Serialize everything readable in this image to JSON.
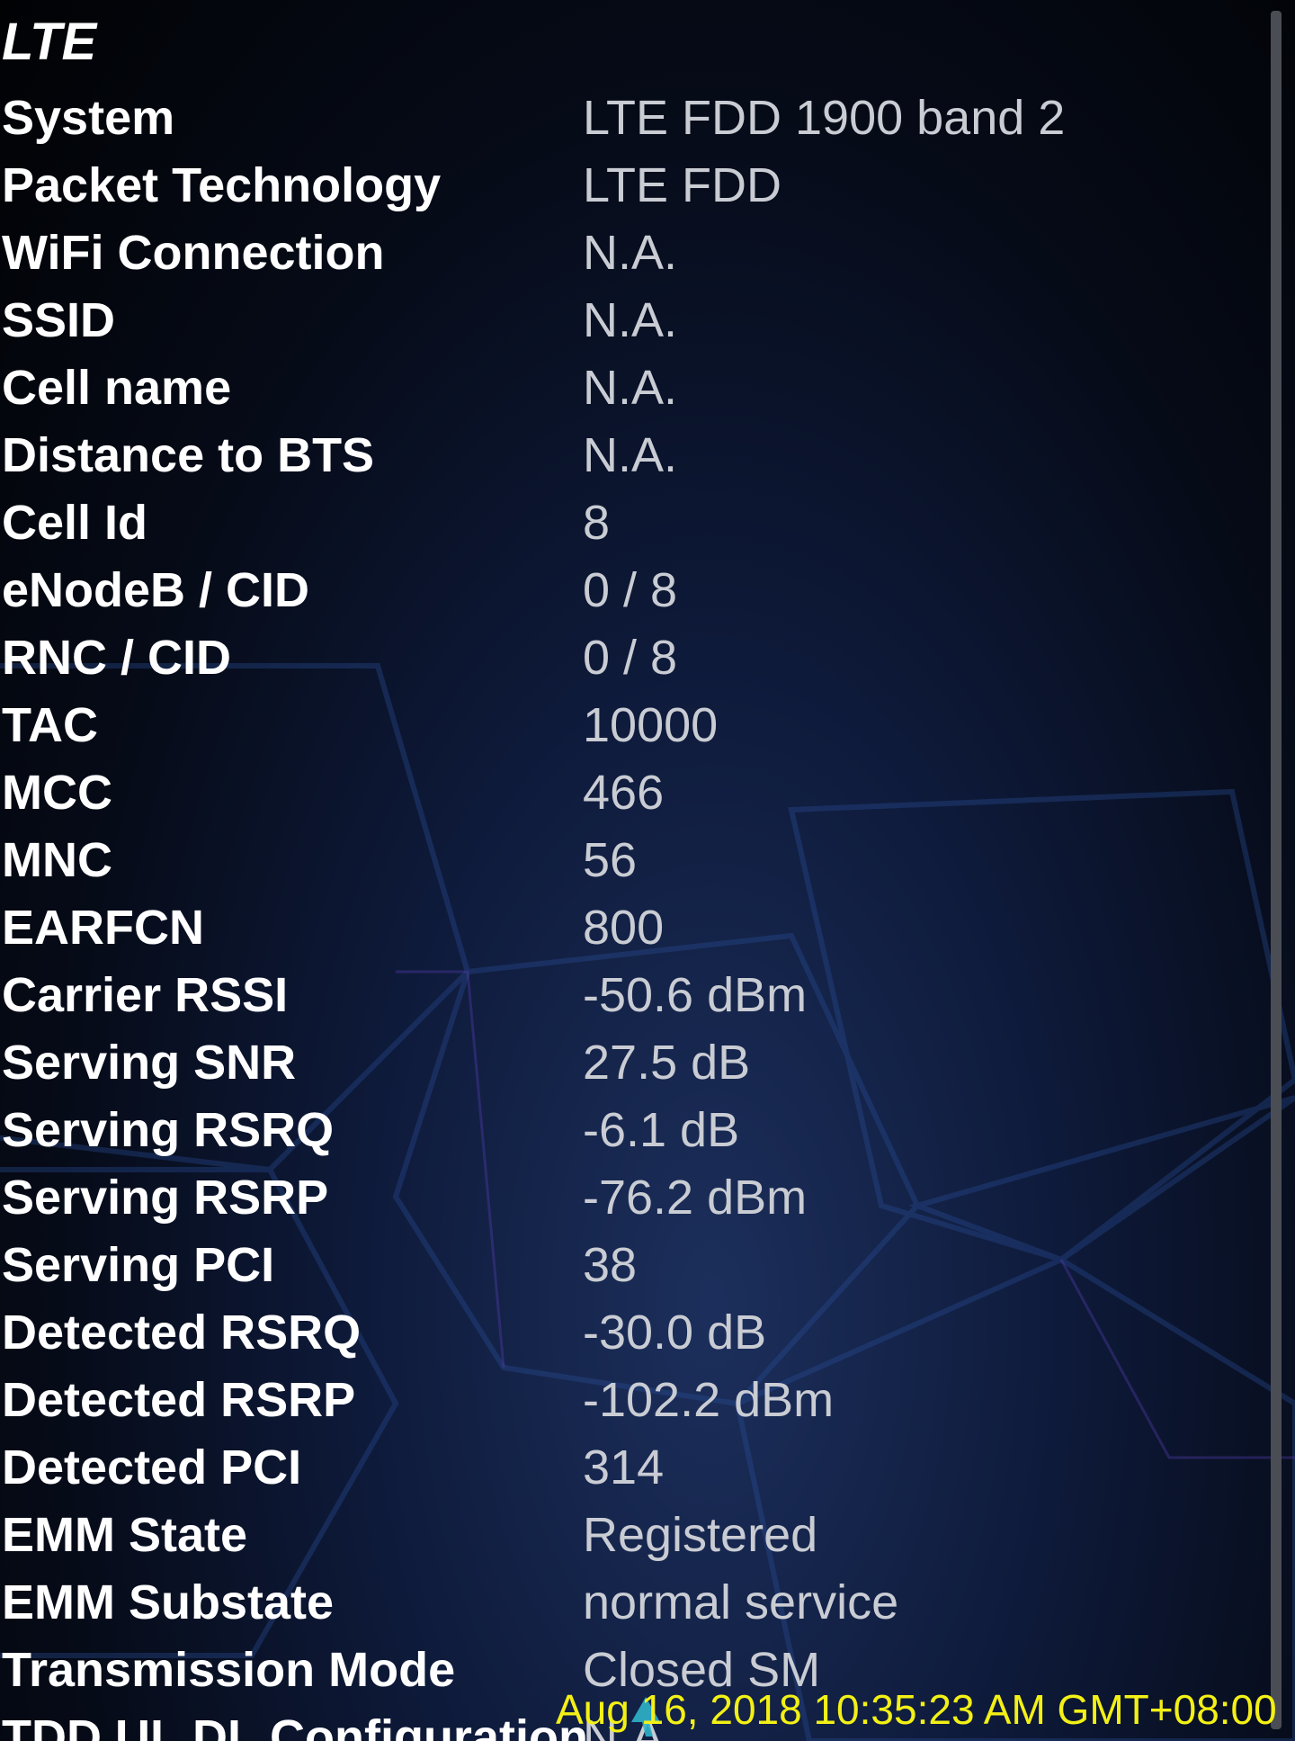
{
  "section": {
    "title": "LTE"
  },
  "rows": [
    {
      "label": "System",
      "value": "LTE FDD 1900 band 2"
    },
    {
      "label": "Packet Technology",
      "value": "LTE FDD"
    },
    {
      "label": "WiFi Connection",
      "value": "N.A."
    },
    {
      "label": "SSID",
      "value": "N.A."
    },
    {
      "label": "Cell name",
      "value": "N.A."
    },
    {
      "label": "Distance to BTS",
      "value": "N.A."
    },
    {
      "label": "Cell Id",
      "value": "8"
    },
    {
      "label": "eNodeB / CID",
      "value": "0 / 8"
    },
    {
      "label": "RNC / CID",
      "value": "0 / 8"
    },
    {
      "label": "TAC",
      "value": "10000"
    },
    {
      "label": "MCC",
      "value": "466"
    },
    {
      "label": "MNC",
      "value": "56"
    },
    {
      "label": "EARFCN",
      "value": "800"
    },
    {
      "label": "Carrier RSSI",
      "value": "-50.6 dBm"
    },
    {
      "label": "Serving SNR",
      "value": "27.5 dB"
    },
    {
      "label": "Serving RSRQ",
      "value": "-6.1 dB"
    },
    {
      "label": "Serving RSRP",
      "value": "-76.2 dBm"
    },
    {
      "label": "Serving PCI",
      "value": "38"
    },
    {
      "label": "Detected RSRQ",
      "value": "-30.0 dB"
    },
    {
      "label": "Detected RSRP",
      "value": "-102.2 dBm"
    },
    {
      "label": "Detected PCI",
      "value": "314"
    },
    {
      "label": "EMM State",
      "value": "Registered"
    },
    {
      "label": "EMM Substate",
      "value": "normal service"
    },
    {
      "label": "Transmission Mode",
      "value": "Closed SM"
    },
    {
      "label": "TDD UL DL Configuration",
      "value": "N.A."
    }
  ],
  "overlay": {
    "timestamp": "Aug 16, 2018 10:35:23 AM GMT+08:00"
  },
  "colors": {
    "label": "#ffffff",
    "value": "#c9ccd3",
    "timestamp": "#f3f016",
    "background": "#0a1430"
  },
  "icons": {
    "cursor": "touch-cursor-icon"
  }
}
